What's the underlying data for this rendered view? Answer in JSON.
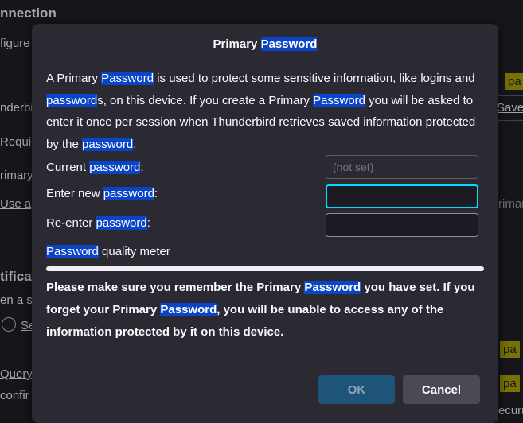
{
  "background": {
    "heading_connection": "nnection",
    "configure_fragment": "figure",
    "thunderbird_fragment": "nderbi",
    "require_fragment": "Requi",
    "primary_fragment": "rimary",
    "use_a_fragment": "Use a",
    "certificates_heading": "tificat",
    "when_fragment": "en a se",
    "select_fragment": "Se",
    "query_fragment": "Query",
    "confirm_fragment": "confir",
    "right_pa_1": "pa",
    "right_pa_2": "pa",
    "right_pa_3": "pa",
    "saved_fragment": "Saved",
    "primar_fragment": "rimar",
    "secur_fragment": "ecuri"
  },
  "dialog": {
    "title_pre": "Primary ",
    "title_hl": "Password",
    "desc": {
      "p1": "A Primary ",
      "h1": "Password",
      "p2": " is used to protect some sensitive information, like logins and ",
      "h2": "password",
      "p3": "s, on this device. If you create a Primary ",
      "h3": "Password",
      "p4": " you will be asked to enter it once per session when Thunderbird retrieves saved information protected by the ",
      "h4": "password",
      "p5": "."
    },
    "current": {
      "pre": "Current ",
      "hl": "password",
      "post": ":",
      "placeholder": "(not set)"
    },
    "new": {
      "pre": "Enter new ",
      "hl": "password",
      "post": ":"
    },
    "reenter": {
      "pre": "Re-enter ",
      "hl": "password",
      "post": ":"
    },
    "meter": {
      "hl": "Password",
      "post": " quality meter",
      "value": 0
    },
    "warning": {
      "p1": "Please make sure you remember the Primary ",
      "h1": "Password",
      "p2": " you have set. If you forget your Primary ",
      "h2": "Password",
      "p3": ", you will be unable to access any of the information protected by it on this device."
    },
    "ok_label": "OK",
    "cancel_label": "Cancel"
  }
}
